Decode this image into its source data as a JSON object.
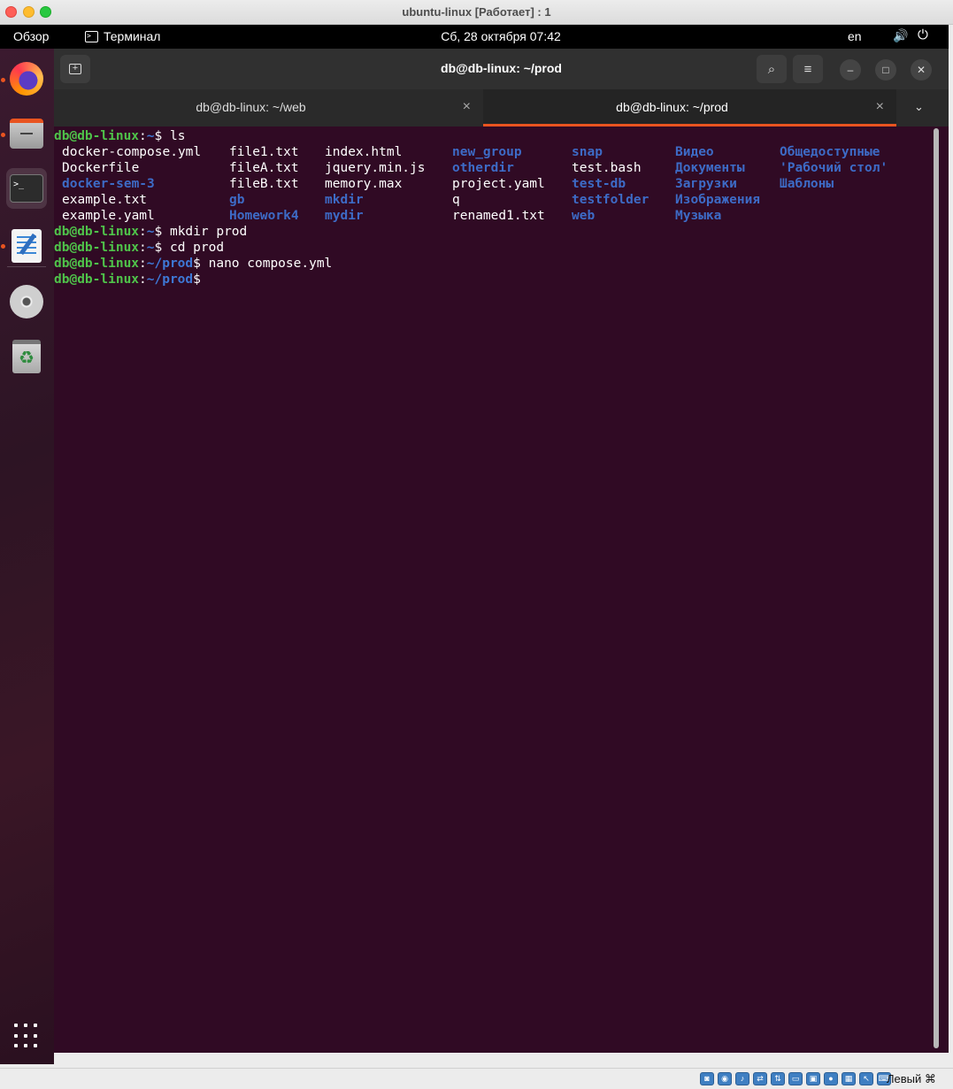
{
  "vm_window": {
    "title": "ubuntu-linux [Работает] : 1"
  },
  "top_panel": {
    "overview": "Обзор",
    "app_name": "Терминал",
    "clock": "Сб, 28 октября  07:42",
    "lang": "en",
    "volume_icon": "🔊",
    "power_icon": "⏻"
  },
  "terminal": {
    "title": "db@db-linux: ~/prod",
    "tabs": [
      {
        "label": "db@db-linux: ~/web",
        "close": "×",
        "active": false
      },
      {
        "label": "db@db-linux: ~/prod",
        "close": "×",
        "active": true
      }
    ],
    "chevron": "⌄",
    "buttons": {
      "search": "⌕",
      "menu": "≡",
      "minimize": "–",
      "maximize": "□",
      "close": "✕",
      "new_tab": "+"
    },
    "prompt_user": "db@db-linux",
    "lines": [
      {
        "path": "~",
        "cmd": "$ ls"
      },
      {
        "path": "~",
        "cmd": "$ mkdir prod"
      },
      {
        "path": "~",
        "cmd": "$ cd prod"
      },
      {
        "path": "~/prod",
        "cmd": "$ nano compose.yml"
      },
      {
        "path": "~/prod",
        "cmd": "$"
      }
    ],
    "ls_rows": [
      [
        "docker-compose.yml",
        "file1.txt",
        "index.html",
        "new_group",
        "snap",
        "Видео",
        "Общедоступные"
      ],
      [
        "Dockerfile",
        "fileA.txt",
        "jquery.min.js",
        "otherdir",
        "test.bash",
        "Документы",
        "'Рабочий стол'"
      ],
      [
        "docker-sem-3",
        "fileB.txt",
        "memory.max",
        "project.yaml",
        "test-db",
        "Загрузки",
        "Шаблоны"
      ],
      [
        "example.txt",
        "gb",
        "mkdir",
        "q",
        "testfolder",
        "Изображения",
        ""
      ],
      [
        "example.yaml",
        "Homework4",
        "mydir",
        "renamed1.txt",
        "web",
        "Музыка",
        ""
      ]
    ],
    "ls_dirs": [
      [
        false,
        false,
        false,
        true,
        true,
        true,
        true
      ],
      [
        false,
        false,
        false,
        true,
        false,
        true,
        true
      ],
      [
        true,
        false,
        false,
        false,
        true,
        true,
        true
      ],
      [
        false,
        true,
        true,
        false,
        true,
        true,
        false
      ],
      [
        false,
        true,
        true,
        false,
        true,
        true,
        false
      ]
    ]
  },
  "statusbar": {
    "host_key": "Левый ⌘"
  },
  "colors": {
    "terminal_bg": "#300a24",
    "accent": "#e95420",
    "prompt_user": "#4fc34a",
    "prompt_path": "#3e78d6"
  }
}
